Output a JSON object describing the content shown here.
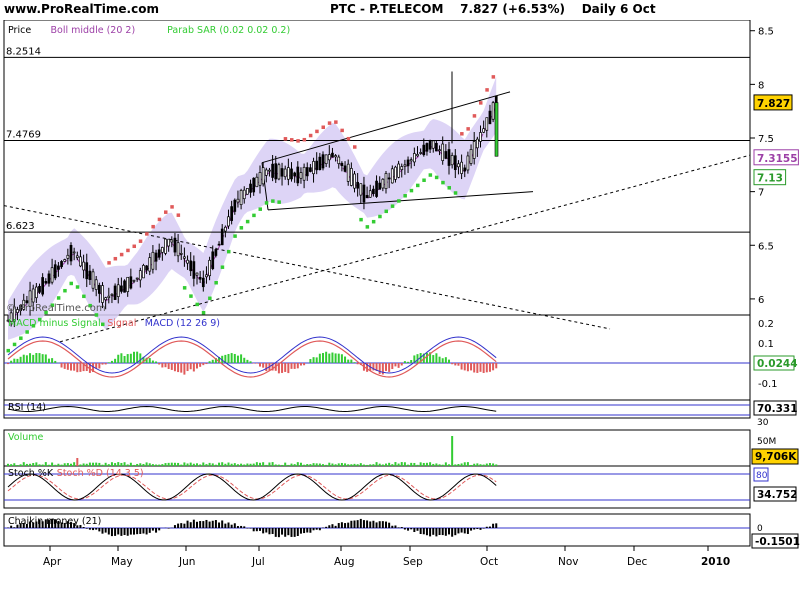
{
  "header": {
    "site": "www.ProRealTime.com",
    "instrument": "PTC - P.TELECOM",
    "last": "7.827",
    "change": "(+6.53%)",
    "period": "Daily",
    "date": "6 Oct"
  },
  "watermark": "© ProRealTime.com",
  "colors": {
    "background": "#ffffff",
    "panel_bg": "#ffffff",
    "bollinger_fill": "#d7ccf5",
    "bollinger_mid": "#9c3fa6",
    "sar_up": "#33cc33",
    "sar_down": "#e05a5a",
    "candle": "#000000",
    "macd_line": "#3333cc",
    "signal_line": "#e05a5a",
    "hist_pos": "#33cc33",
    "hist_neg": "#e05a5a",
    "volume": "#33cc33",
    "stoch_k": "#000000",
    "stoch_d": "#e05a5a",
    "chaikin": "#000000",
    "label_bg_yellow": "#ffd200"
  },
  "chart_data": [
    {
      "id": "price",
      "type": "candlestick",
      "legend": [
        {
          "label": "Price",
          "color": "#000000"
        },
        {
          "label": "Boll middle (20 2)",
          "color": "#9c3fa6"
        },
        {
          "label": "Parab SAR (0.02 0.02 0.2)",
          "color": "#33cc33"
        }
      ],
      "yticks": [
        "8.5",
        "8",
        "7.5",
        "7",
        "6.5",
        "6"
      ],
      "ylim": [
        5.85,
        8.6
      ],
      "xticks": [
        "Apr",
        "May",
        "Jun",
        "Jul",
        "Aug",
        "Sep",
        "Oct",
        "Nov",
        "Dec",
        "2010"
      ],
      "hlines": [
        {
          "label": "8.2514",
          "value": 8.2514
        },
        {
          "label": "7.4769",
          "value": 7.4769
        },
        {
          "label": "6.623",
          "value": 6.623
        }
      ],
      "price_labels": [
        {
          "text": "7.827",
          "style": "yellow"
        },
        {
          "text": "7.3155",
          "style": "purple"
        },
        {
          "text": "7.13",
          "style": "green"
        }
      ],
      "trend": [
        {
          "name": "Apr",
          "value": 5.8
        },
        {
          "name": "Apr",
          "value": 6.1
        },
        {
          "name": "May",
          "value": 6.45
        },
        {
          "name": "May",
          "value": 6.0
        },
        {
          "name": "Jun",
          "value": 6.2
        },
        {
          "name": "Jun",
          "value": 6.55
        },
        {
          "name": "Jun",
          "value": 6.15
        },
        {
          "name": "Jul",
          "value": 6.9
        },
        {
          "name": "Jul",
          "value": 7.2
        },
        {
          "name": "Aug",
          "value": 7.15
        },
        {
          "name": "Aug",
          "value": 7.35
        },
        {
          "name": "Aug",
          "value": 6.95
        },
        {
          "name": "Sep",
          "value": 7.2
        },
        {
          "name": "Sep",
          "value": 7.45
        },
        {
          "name": "Sep",
          "value": 7.2
        },
        {
          "name": "Oct",
          "value": 7.827
        }
      ]
    },
    {
      "id": "macd",
      "type": "line",
      "legend": [
        {
          "label": "MACD minus Signal",
          "color": "#33cc33"
        },
        {
          "label": "Signal",
          "color": "#e05a5a"
        },
        {
          "label": "MACD (12 26 9)",
          "color": "#3333cc"
        }
      ],
      "yticks": [
        "0.2",
        "0.1",
        "0",
        "-0.1"
      ],
      "last_label": "0.0244"
    },
    {
      "id": "rsi",
      "type": "line",
      "legend": [
        {
          "label": "RSI (14)",
          "color": "#000000"
        }
      ],
      "yticks": [
        "70",
        "30"
      ],
      "last_label": "70.331"
    },
    {
      "id": "volume",
      "type": "bar",
      "legend": [
        {
          "label": "Volume",
          "color": "#33cc33"
        }
      ],
      "yticks": [
        "50M"
      ],
      "last_label": "9,706K"
    },
    {
      "id": "stoch",
      "type": "line",
      "legend": [
        {
          "label": "Stoch %K",
          "color": "#000000"
        },
        {
          "label": "Stoch %D (14 3 5)",
          "color": "#e05a5a"
        }
      ],
      "yticks": [
        "80"
      ],
      "last_label": "34.752"
    },
    {
      "id": "chaikin",
      "type": "bar",
      "legend": [
        {
          "label": "Chaikin money (21)",
          "color": "#000000"
        }
      ],
      "yticks": [
        "0"
      ],
      "last_label": "-0.1501"
    }
  ]
}
